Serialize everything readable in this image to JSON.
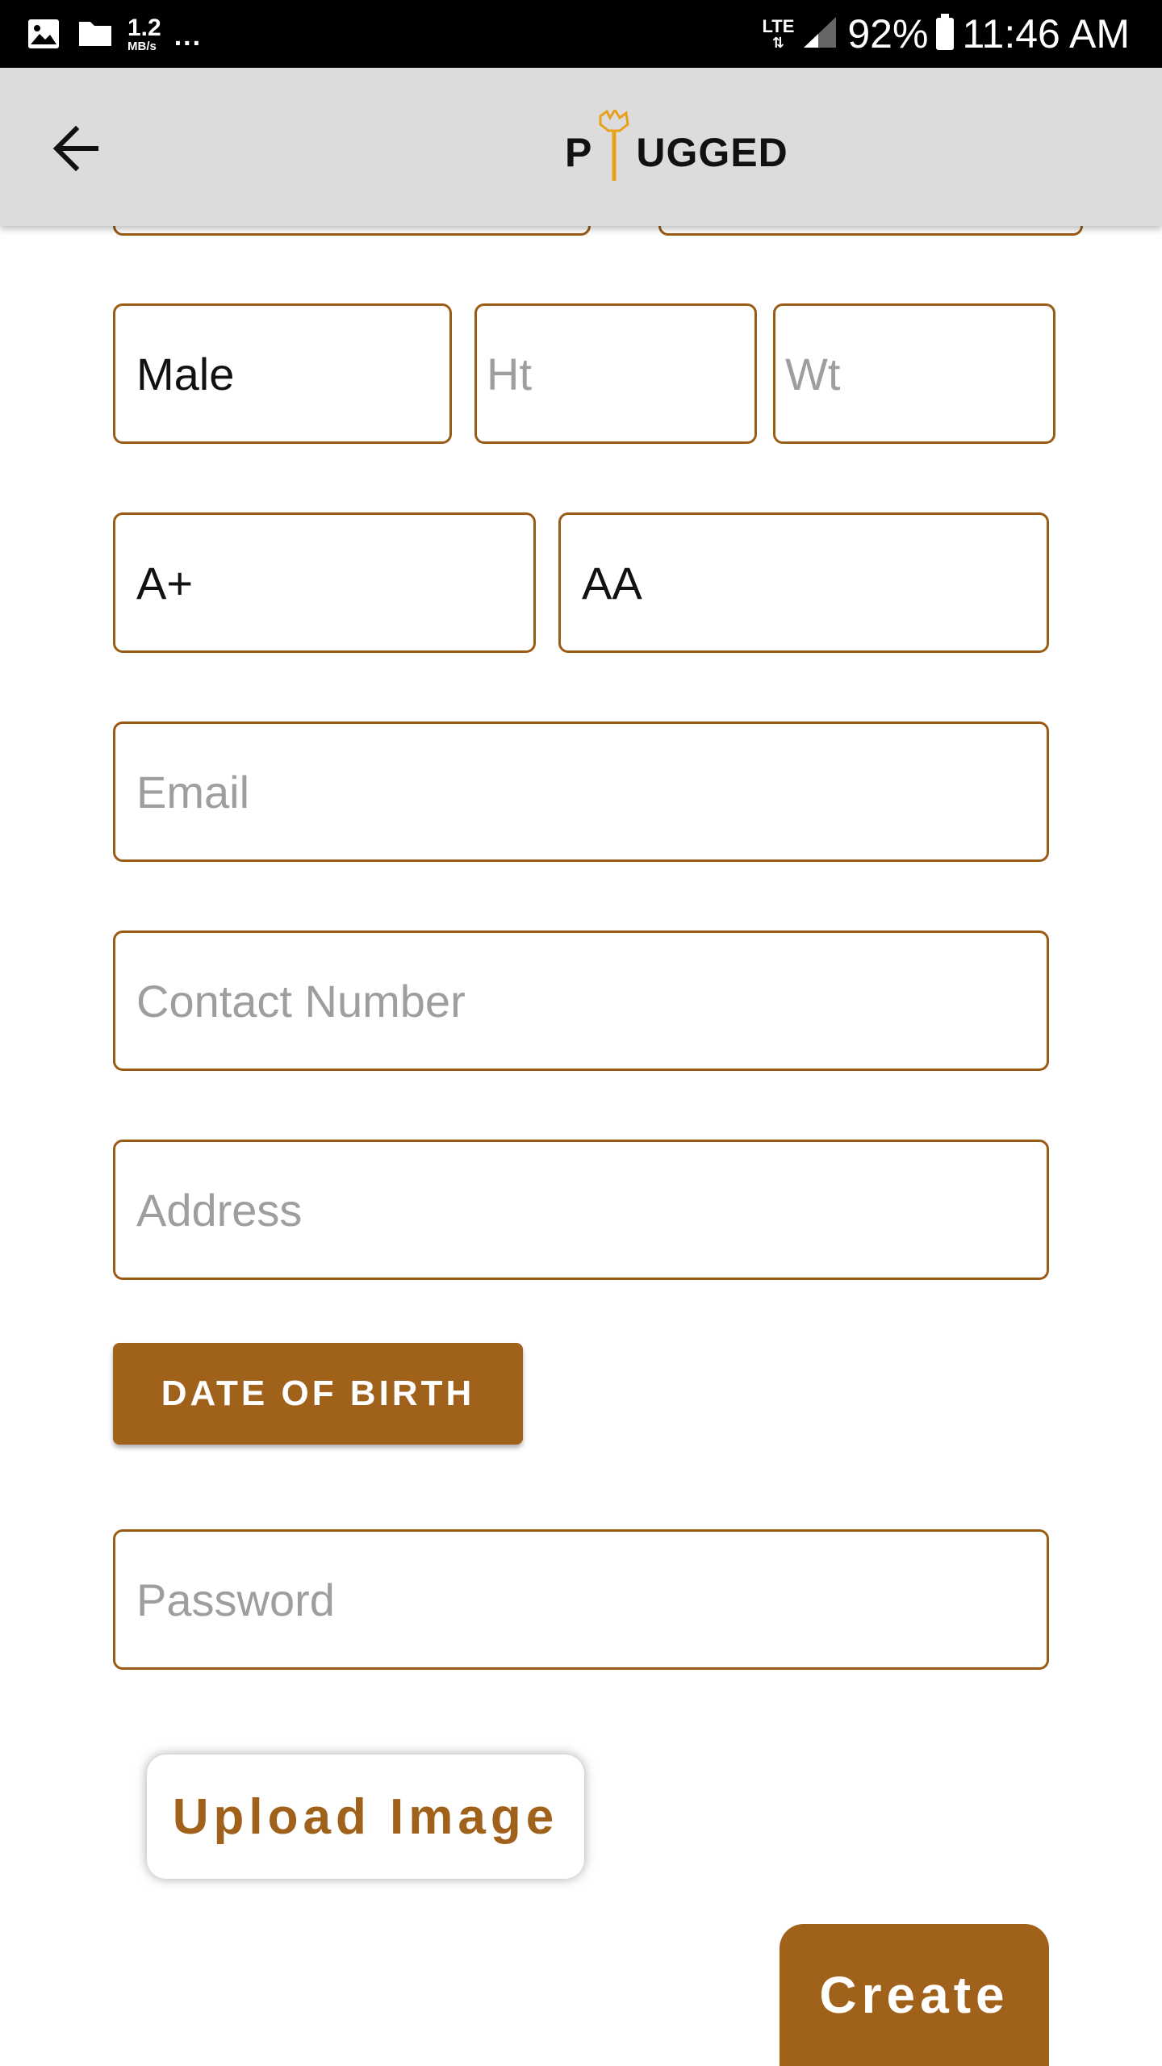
{
  "status_bar": {
    "speed": "1.2",
    "speed_unit": "MB/s",
    "more": "...",
    "network": "LTE",
    "battery": "92%",
    "time": "11:46 AM"
  },
  "app_bar": {
    "logo_text_left": "P",
    "logo_text_right": "UGGED"
  },
  "form": {
    "gender": "Male",
    "height_placeholder": "Ht",
    "weight_placeholder": "Wt",
    "blood_group": "A+",
    "genotype": "AA",
    "email_placeholder": "Email",
    "contact_placeholder": "Contact Number",
    "address_placeholder": "Address",
    "dob_label": "DATE OF BIRTH",
    "password_placeholder": "Password",
    "upload_label": "Upload Image",
    "create_label": "Create"
  },
  "colors": {
    "accent": "#a0611a",
    "border": "#9a5c14",
    "logo_accent": "#e8a21a"
  }
}
